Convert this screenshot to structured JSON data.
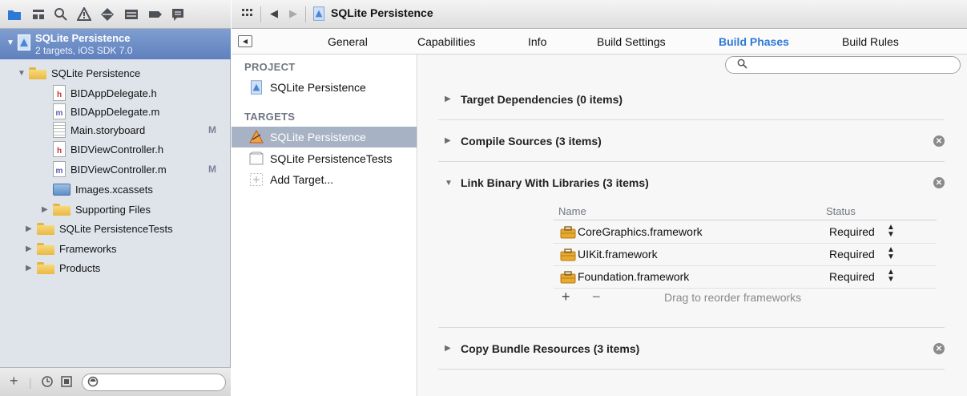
{
  "navigator": {
    "toolbar_icons": [
      "folder-icon",
      "hierarchy-icon",
      "search-icon",
      "warning-icon",
      "test-icon",
      "debug-icon",
      "breakpoint-icon",
      "log-icon"
    ],
    "project": {
      "name": "SQLite Persistence",
      "subtitle": "2 targets, iOS SDK 7.0"
    },
    "tree": [
      {
        "label": "SQLite Persistence",
        "type": "folder",
        "expanded": true
      },
      {
        "label": "BIDAppDelegate.h",
        "type": "h"
      },
      {
        "label": "BIDAppDelegate.m",
        "type": "m"
      },
      {
        "label": "Main.storyboard",
        "type": "storyboard",
        "badge": "M"
      },
      {
        "label": "BIDViewController.h",
        "type": "h"
      },
      {
        "label": "BIDViewController.m",
        "type": "m",
        "badge": "M"
      },
      {
        "label": "Images.xcassets",
        "type": "assets"
      },
      {
        "label": "Supporting Files",
        "type": "folder",
        "expanded": false
      },
      {
        "label": "SQLite PersistenceTests",
        "type": "folder",
        "expanded": false
      },
      {
        "label": "Frameworks",
        "type": "folder",
        "expanded": false
      },
      {
        "label": "Products",
        "type": "folder",
        "expanded": false
      }
    ],
    "footer": {
      "add": "+",
      "recent_icon": "clock-icon",
      "scm_icon": "scm-icon"
    }
  },
  "jumpbar": {
    "title": "SQLite Persistence"
  },
  "tabs": [
    "General",
    "Capabilities",
    "Info",
    "Build Settings",
    "Build Phases",
    "Build Rules"
  ],
  "active_tab": "Build Phases",
  "targets_pane": {
    "project_header": "PROJECT",
    "project_item": "SQLite Persistence",
    "targets_header": "TARGETS",
    "targets": [
      "SQLite Persistence",
      "SQLite PersistenceTests"
    ],
    "selected_target": "SQLite Persistence",
    "add_target": "Add Target..."
  },
  "phases": [
    {
      "title": "Target Dependencies (0 items)",
      "expanded": false,
      "deletable": false
    },
    {
      "title": "Compile Sources (3 items)",
      "expanded": false,
      "deletable": true
    },
    {
      "title": "Link Binary With Libraries (3 items)",
      "expanded": true,
      "deletable": true
    },
    {
      "title": "Copy Bundle Resources (3 items)",
      "expanded": false,
      "deletable": true
    }
  ],
  "libraries": {
    "col_name": "Name",
    "col_status": "Status",
    "rows": [
      {
        "name": "CoreGraphics.framework",
        "status": "Required"
      },
      {
        "name": "UIKit.framework",
        "status": "Required"
      },
      {
        "name": "Foundation.framework",
        "status": "Required"
      }
    ],
    "add": "+",
    "remove": "−",
    "hint": "Drag to reorder frameworks"
  },
  "colors": {
    "accent": "#2d7ad6",
    "selection": "#a7b3c4",
    "project_row": "#6f8fc8"
  }
}
